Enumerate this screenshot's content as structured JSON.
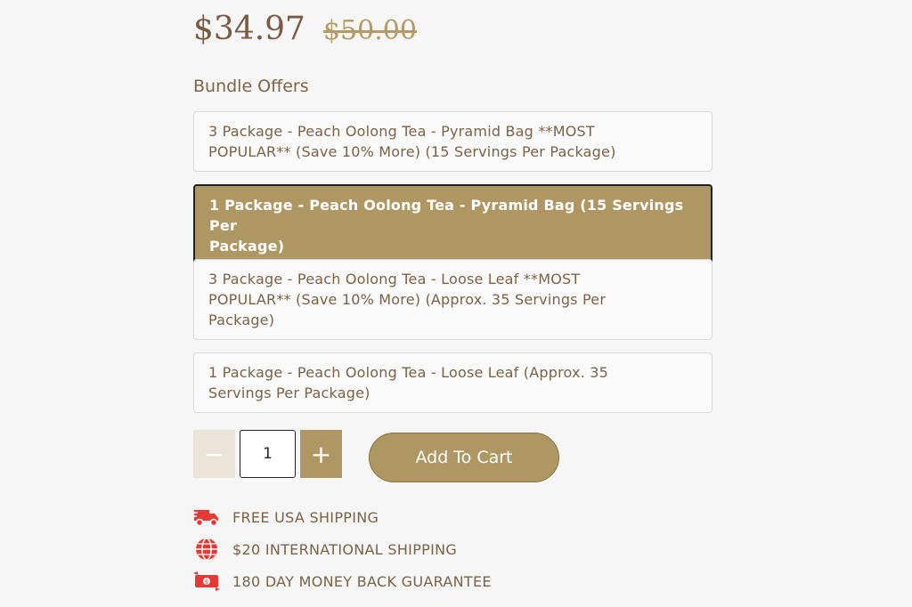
{
  "price": {
    "current": "$34.97",
    "original": "$50.00"
  },
  "bundle": {
    "title": "Bundle Offers",
    "offers": [
      {
        "line1": "3 Package - Peach Oolong Tea - Pyramid Bag **MOST",
        "line2": "POPULAR** (Save 10% More) (15 Servings Per Package)",
        "line3": ""
      },
      {
        "line1": "1 Package - Peach Oolong Tea - Pyramid Bag (15 Servings Per",
        "line2": "Package)",
        "line3": ""
      },
      {
        "line1": "3 Package - Peach Oolong Tea - Loose Leaf **MOST",
        "line2": "POPULAR** (Save 10% More) (Approx. 35 Servings Per",
        "line3": "Package)"
      },
      {
        "line1": "1 Package - Peach Oolong Tea - Loose Leaf (Approx. 35",
        "line2": "Servings Per Package)",
        "line3": ""
      }
    ],
    "selected_index": 1
  },
  "quantity": {
    "minus": "−",
    "plus": "+",
    "value": "1"
  },
  "cart": {
    "add_label": "Add To Cart"
  },
  "features": [
    {
      "icon": "truck-icon",
      "label": "FREE USA SHIPPING"
    },
    {
      "icon": "globe-icon",
      "label": "$20 INTERNATIONAL SHIPPING"
    },
    {
      "icon": "money-back-icon",
      "label": "180 DAY MONEY BACK GUARANTEE"
    }
  ],
  "colors": {
    "accent": "#ae9763",
    "icon_red": "#e53935",
    "text": "#7a6247"
  }
}
